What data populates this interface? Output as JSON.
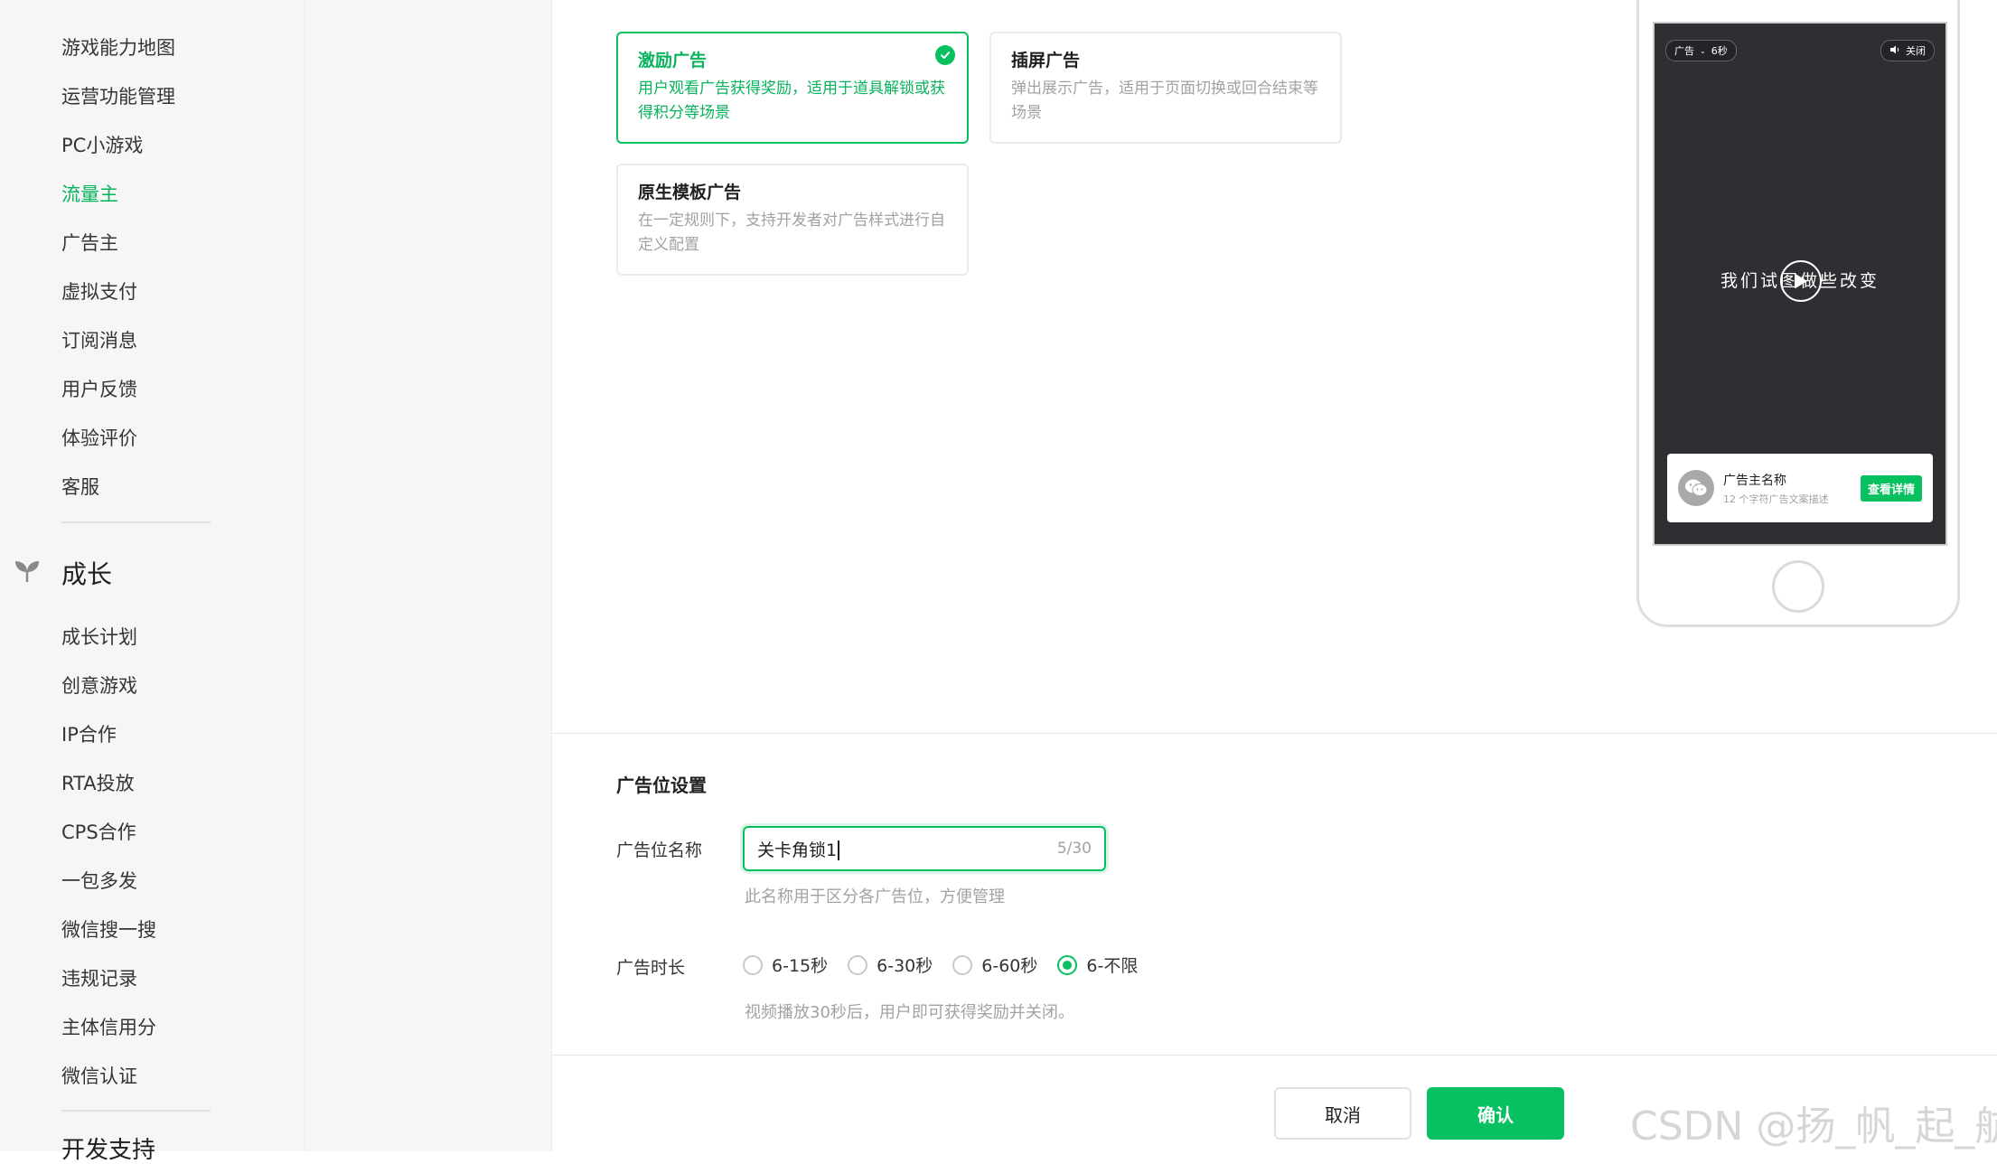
{
  "sidebar": {
    "items_top": [
      {
        "label": "游戏能力地图",
        "active": false
      },
      {
        "label": "运营功能管理",
        "active": false
      },
      {
        "label": "PC小游戏",
        "active": false
      },
      {
        "label": "流量主",
        "active": true
      },
      {
        "label": "广告主",
        "active": false
      },
      {
        "label": "虚拟支付",
        "active": false
      },
      {
        "label": "订阅消息",
        "active": false
      },
      {
        "label": "用户反馈",
        "active": false
      },
      {
        "label": "体验评价",
        "active": false
      },
      {
        "label": "客服",
        "active": false
      }
    ],
    "section_title": "成长",
    "items_growth": [
      {
        "label": "成长计划"
      },
      {
        "label": "创意游戏"
      },
      {
        "label": "IP合作"
      },
      {
        "label": "RTA投放"
      },
      {
        "label": "CPS合作"
      },
      {
        "label": "一包多发"
      },
      {
        "label": "微信搜一搜"
      },
      {
        "label": "违规记录"
      },
      {
        "label": "主体信用分"
      },
      {
        "label": "微信认证"
      }
    ],
    "next_section_partial": "开发支持"
  },
  "ad_types": [
    {
      "title": "激励广告",
      "desc": "用户观看广告获得奖励，适用于道具解锁或获得积分等场景",
      "selected": true
    },
    {
      "title": "插屏广告",
      "desc": "弹出展示广告，适用于页面切换或回合结束等场景",
      "selected": false
    },
    {
      "title": "原生模板广告",
      "desc": "在一定规则下，支持开发者对广告样式进行自定义配置",
      "selected": false
    }
  ],
  "preview": {
    "ad_tag": "广告",
    "countdown": "6秒",
    "mute_close": "关闭",
    "video_text": "我们试图做些改变",
    "advertiser_name": "广告主名称",
    "advertiser_desc": "12 个字符广告文案描述",
    "detail_button": "查看详情"
  },
  "settings": {
    "title": "广告位设置",
    "name_label": "广告位名称",
    "name_value": "关卡角锁1",
    "name_count": "5/30",
    "name_hint": "此名称用于区分各广告位，方便管理",
    "duration_label": "广告时长",
    "duration_options": [
      "6-15秒",
      "6-30秒",
      "6-60秒",
      "6-不限"
    ],
    "duration_selected_index": 3,
    "duration_hint": "视频播放30秒后，用户即可获得奖励并关闭。"
  },
  "footer": {
    "cancel_label": "取消",
    "confirm_label": "确认"
  },
  "watermark": "CSDN @扬_帆_起_航",
  "colors": {
    "accent": "#07c160",
    "accent_text": "#07b35b",
    "muted_text": "#a2a2a2",
    "phone_screen": "#2e2f33"
  }
}
